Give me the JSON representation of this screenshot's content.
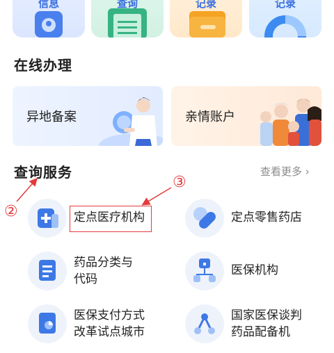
{
  "top_cards": [
    {
      "label": "信息"
    },
    {
      "label": "查询"
    },
    {
      "label": "记录"
    },
    {
      "label": "记录"
    }
  ],
  "online": {
    "title": "在线办理",
    "cards": [
      {
        "label": "异地备案"
      },
      {
        "label": "亲情账户"
      }
    ]
  },
  "query": {
    "title": "查询服务",
    "more": "查看更多",
    "items": [
      {
        "line1": "定点医疗机构",
        "line2": ""
      },
      {
        "line1": "定点零售药店",
        "line2": ""
      },
      {
        "line1": "药品分类与",
        "line2": "代码"
      },
      {
        "line1": "医保机构",
        "line2": ""
      },
      {
        "line1": "医保支付方式",
        "line2": "改革试点城市"
      },
      {
        "line1": "国家医保谈判",
        "line2": "药品配备机"
      }
    ]
  },
  "annotations": {
    "two": "②",
    "three": "③"
  }
}
